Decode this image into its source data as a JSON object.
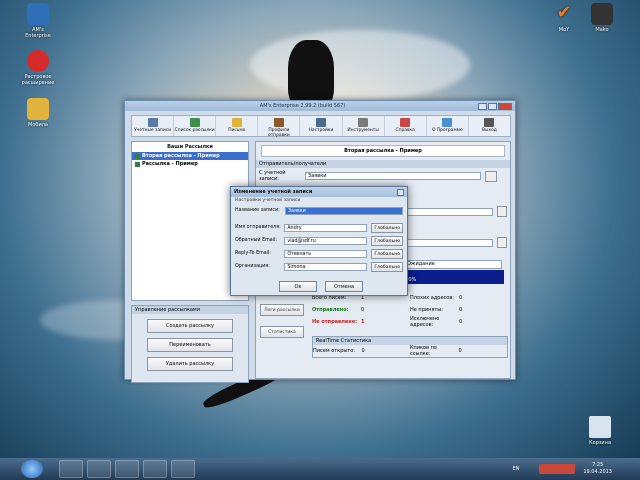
{
  "desktop": {
    "icons_left": [
      {
        "label": "AM's\nEnterprise",
        "icon": "at-sign-icon",
        "color": "#2f6fb8"
      },
      {
        "label": "Растровое\nрасширение",
        "icon": "red-ball-icon",
        "color": "#d62b2b"
      },
      {
        "label": "Мобила",
        "icon": "folder-icon",
        "color": "#e0b43c"
      }
    ],
    "icons_right": [
      {
        "label": "MoY",
        "icon": "checkmark-icon",
        "color": "#f07a1c"
      },
      {
        "label": "Mako",
        "icon": "device-icon",
        "color": "#333333"
      }
    ],
    "recycle_bin_label": "Корзина"
  },
  "window": {
    "title": "AM's Enterprise 2.99.2 (build 567)",
    "toolbar": [
      {
        "label": "Учетные записи",
        "color": "#5a7ba3"
      },
      {
        "label": "Список рассылки",
        "color": "#3f8f4a"
      },
      {
        "label": "Письмо",
        "color": "#e0b43c"
      },
      {
        "label": "Профили отправки",
        "color": "#8b5a2b"
      },
      {
        "label": "Настройки",
        "color": "#4c6a8f"
      },
      {
        "label": "Инструменты",
        "color": "#7a7a7a"
      },
      {
        "label": "Справка",
        "color": "#c44"
      },
      {
        "label": "О Программе",
        "color": "#4a90d0"
      },
      {
        "label": "Выход",
        "color": "#555"
      }
    ],
    "list_header": "Ваши Рассылки",
    "mailings": [
      {
        "label": "Вторая рассылка - Пример",
        "selected": true
      },
      {
        "label": "Рассылка - Пример",
        "selected": false
      }
    ],
    "management_caption": "Управление рассылками",
    "management_buttons": [
      "Создать рассылку",
      "Переименовать",
      "Удалить рассылку"
    ],
    "right_title": "Вторая рассылка - Пример",
    "sender_section": "Отправитель/получатели",
    "from_account_label": "С учетной записи:",
    "from_account_value": "Заявки",
    "side_buttons": [
      "Старт",
      "Статус рассылок",
      "Логи рассылки",
      "Статистика"
    ],
    "waiting": "Ожидание",
    "progress": "100%",
    "stats": [
      {
        "label": "Всего писем:",
        "value": "1",
        "label2": "Плохих адресов:",
        "value2": "0"
      },
      {
        "label": "Отправлено:",
        "value": "0",
        "label2": "Не приняты:",
        "value2": "0"
      },
      {
        "label": "Не отправлено:",
        "value": "1",
        "label2": "Исключено адресов:",
        "value2": "0"
      }
    ],
    "realtime_caption": "RealTime Статистика",
    "opened_label": "Писем открыто:",
    "opened_value": "0",
    "clicks_label": "Кликов по ссылке:",
    "clicks_value": "0"
  },
  "dialog": {
    "title": "Изменение учетной записи",
    "section": "Настройки учетной записи",
    "name_label": "Название записи:",
    "name_value": "Заявки",
    "fields": [
      {
        "label": "Имя отправителя:",
        "value": "Andry",
        "help": "Глобально"
      },
      {
        "label": "Обратный Email:",
        "value": "vlad@sdf.ru",
        "help": "Глобально"
      },
      {
        "label": "Reply-To Email:",
        "value": "Отвечать",
        "help": "Глобально"
      },
      {
        "label": "Организация:",
        "value": "Simona",
        "help": "Глобально"
      }
    ],
    "ok": "Ок",
    "cancel": "Отмена"
  },
  "taskbar": {
    "lang": "EN",
    "time": "7:25",
    "date": "19.04.2013"
  }
}
